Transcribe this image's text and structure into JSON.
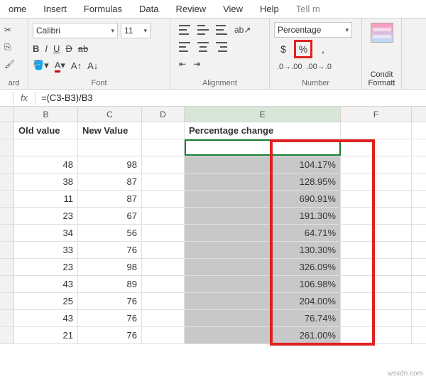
{
  "ribbon_tabs": [
    "ome",
    "Insert",
    "Formulas",
    "Data",
    "Review",
    "View",
    "Help",
    "Tell m"
  ],
  "font": {
    "name": "Calibri",
    "size": "11"
  },
  "number_format": "Percentage",
  "group_labels": {
    "clipboard": "ard",
    "font": "Font",
    "alignment": "Alignment",
    "number": "Number"
  },
  "condfmt": {
    "l1": "Condit",
    "l2": "Formatt"
  },
  "formula": "=(C3-B3)/B3",
  "columns": [
    "B",
    "C",
    "D",
    "E",
    "F"
  ],
  "headers": {
    "B": "Old value",
    "C": "New Value",
    "E": "Percentage change"
  },
  "chart_data": {
    "type": "table",
    "columns": [
      "Old value",
      "New Value",
      "Percentage change"
    ],
    "rows": [
      {
        "old": 48,
        "new": 98,
        "pct": "104.17%"
      },
      {
        "old": 38,
        "new": 87,
        "pct": "128.95%"
      },
      {
        "old": 11,
        "new": 87,
        "pct": "690.91%"
      },
      {
        "old": 23,
        "new": 67,
        "pct": "191.30%"
      },
      {
        "old": 34,
        "new": 56,
        "pct": "64.71%"
      },
      {
        "old": 33,
        "new": 76,
        "pct": "130.30%"
      },
      {
        "old": 23,
        "new": 98,
        "pct": "326.09%"
      },
      {
        "old": 43,
        "new": 89,
        "pct": "106.98%"
      },
      {
        "old": 25,
        "new": 76,
        "pct": "204.00%"
      },
      {
        "old": 43,
        "new": 76,
        "pct": "76.74%"
      },
      {
        "old": 21,
        "new": 76,
        "pct": "261.00%"
      }
    ]
  },
  "watermark": "wsxdn.com"
}
